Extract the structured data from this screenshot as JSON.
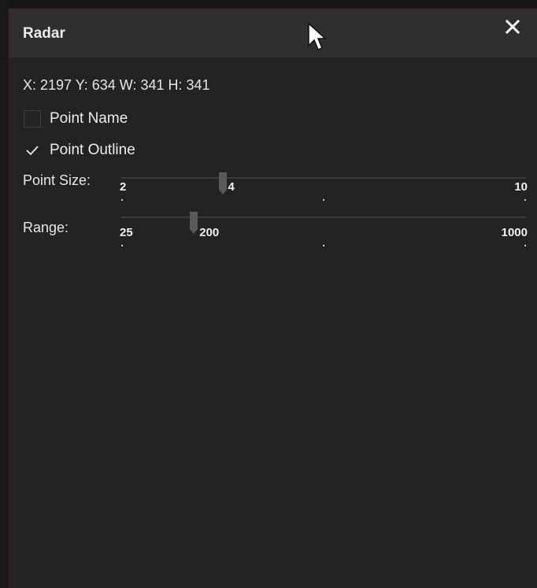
{
  "window": {
    "title": "Radar"
  },
  "info": {
    "coords_text": "X: 2197 Y: 634 W: 341 H: 341"
  },
  "options": [
    {
      "label": "Point Name",
      "checked": false
    },
    {
      "label": "Point Outline",
      "checked": true
    }
  ],
  "point_size": {
    "label": "Point Size:",
    "min_label": "2",
    "value_label": "4",
    "max_label": "10",
    "min": 2,
    "max": 10,
    "value": 4
  },
  "range": {
    "label": "Range:",
    "min_label": "25",
    "value_label": "200",
    "max_label": "1000",
    "min": 25,
    "max": 1000,
    "value": 200
  },
  "icons": {
    "close": "close-icon",
    "check": "checkmark-icon",
    "cursor": "mouse-pointer-icon"
  },
  "colors": {
    "background": "#232323",
    "titlebar": "#2f2f2f",
    "text": "#ececec"
  }
}
